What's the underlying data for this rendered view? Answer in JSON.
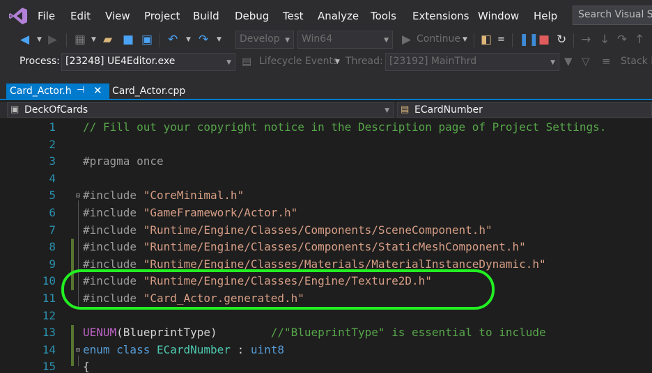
{
  "menu": [
    "File",
    "Edit",
    "View",
    "Project",
    "Build",
    "Debug",
    "Test",
    "Analyze",
    "Tools",
    "Extensions",
    "Window",
    "Help"
  ],
  "search_placeholder": "Search Visual Studio",
  "toolbar": {
    "configuration": "Develop",
    "platform": "Win64",
    "continue_label": "Continue"
  },
  "toolbar2": {
    "process_label": "Process:",
    "process_value": "[23248] UE4Editor.exe",
    "lifecycle_label": "Lifecycle Events",
    "thread_label": "Thread:",
    "thread_value": "[23192] MainThrd",
    "stack_label": "Stack Fr"
  },
  "tabs": [
    {
      "label": "Card_Actor.h",
      "active": true
    },
    {
      "label": "Card_Actor.cpp",
      "active": false
    }
  ],
  "nav": {
    "scope": "DeckOfCards",
    "member": "ECardNumber"
  },
  "code_lines": [
    {
      "num": "1",
      "parts": [
        {
          "t": "// Fill out your copyright notice in the Description page of Project Settings.",
          "c": "c-comment"
        }
      ]
    },
    {
      "num": "2",
      "parts": []
    },
    {
      "num": "3",
      "parts": [
        {
          "t": "#pragma once",
          "c": "c-pre"
        }
      ]
    },
    {
      "num": "4",
      "parts": []
    },
    {
      "num": "5",
      "parts": [
        {
          "t": "#include ",
          "c": "c-pre"
        },
        {
          "t": "\"CoreMinimal.h\"",
          "c": "c-str"
        }
      ]
    },
    {
      "num": "6",
      "parts": [
        {
          "t": "#include ",
          "c": "c-pre"
        },
        {
          "t": "\"GameFramework/Actor.h\"",
          "c": "c-str"
        }
      ]
    },
    {
      "num": "7",
      "parts": [
        {
          "t": "#include ",
          "c": "c-pre"
        },
        {
          "t": "\"Runtime/Engine/Classes/Components/SceneComponent.h\"",
          "c": "c-str"
        }
      ]
    },
    {
      "num": "8",
      "parts": [
        {
          "t": "#include ",
          "c": "c-pre"
        },
        {
          "t": "\"Runtime/Engine/Classes/Components/StaticMeshComponent.h\"",
          "c": "c-str"
        }
      ]
    },
    {
      "num": "9",
      "parts": [
        {
          "t": "#include ",
          "c": "c-pre"
        },
        {
          "t": "\"Runtime/Engine/Classes/Materials/MaterialInstanceDynamic.h\"",
          "c": "c-str"
        }
      ]
    },
    {
      "num": "10",
      "parts": [
        {
          "t": "#include ",
          "c": "c-pre"
        },
        {
          "t": "\"Runtime/Engine/Classes/Engine/Texture2D.h\"",
          "c": "c-str"
        }
      ]
    },
    {
      "num": "11",
      "parts": [
        {
          "t": "#include ",
          "c": "c-pre"
        },
        {
          "t": "\"Card_Actor.generated.h\"",
          "c": "c-str"
        }
      ]
    },
    {
      "num": "12",
      "parts": []
    },
    {
      "num": "13",
      "parts": [
        {
          "t": "UENUM",
          "c": "c-macro"
        },
        {
          "t": "(BlueprintType)        ",
          "c": ""
        },
        {
          "t": "//\"BlueprintType\" is essential to include",
          "c": "c-comment"
        }
      ]
    },
    {
      "num": "14",
      "parts": [
        {
          "t": "enum class ",
          "c": "c-kw"
        },
        {
          "t": "ECardNumber",
          "c": "c-type"
        },
        {
          "t": " : ",
          "c": ""
        },
        {
          "t": "uint8",
          "c": "c-kw"
        }
      ]
    },
    {
      "num": "15",
      "parts": [
        {
          "t": "{",
          "c": ""
        }
      ]
    }
  ],
  "colors": {
    "accent": "#007acc",
    "highlight_ring": "#22ee22",
    "comment": "#57a64a",
    "string": "#d69d85",
    "keyword": "#569cd6",
    "type": "#4ec9b0",
    "line_number": "#2b91af"
  }
}
